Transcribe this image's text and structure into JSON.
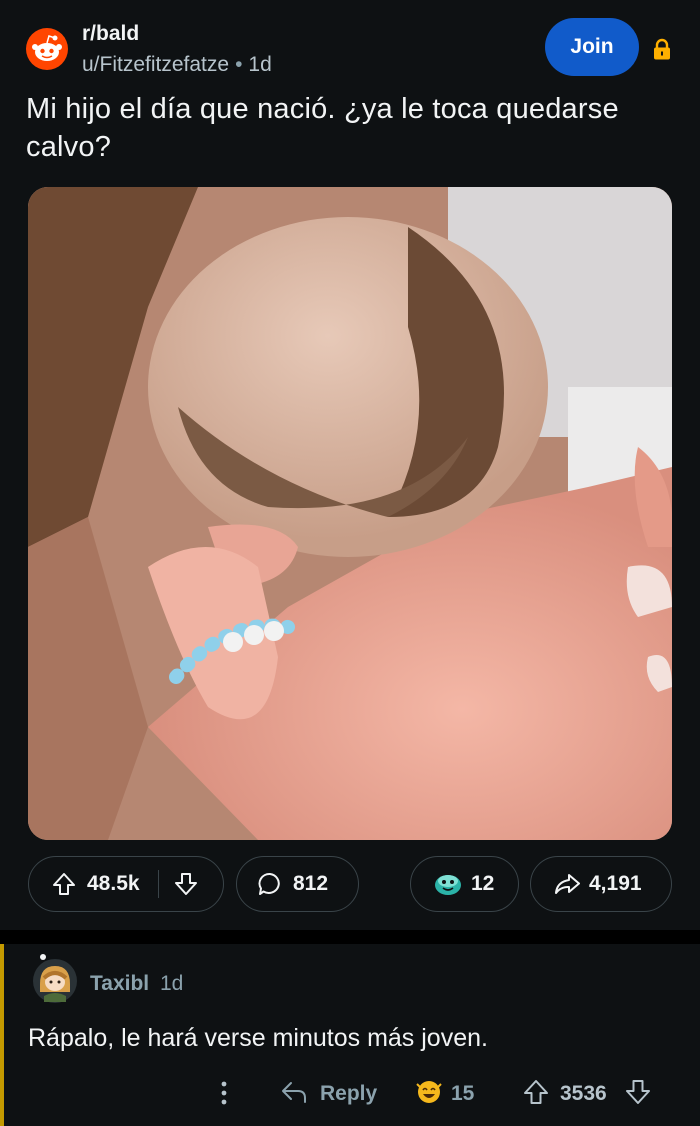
{
  "post": {
    "subreddit": "r/bald",
    "author": "u/Fitzefitzefatze",
    "separator": "•",
    "age": "1d",
    "join_label": "Join",
    "title": "Mi hijo el día que nació. ¿ya le toca quedarse calvo?",
    "votes": "48.5k",
    "comments": "812",
    "awards": "12",
    "shares": "4,191"
  },
  "comment": {
    "author": "Taxibl",
    "age": "1d",
    "text": "Rápalo, le hará verse minutos más joven.",
    "reply_label": "Reply",
    "awards": "15",
    "score": "3536"
  },
  "colors": {
    "background": "#0e1113",
    "join_button": "#115bca",
    "subreddit_icon": "#ff4500",
    "lock": "#ffb000",
    "thread_bar": "#c49a00"
  },
  "icons": {
    "lock": "lock-icon",
    "upvote": "arrow-up-icon",
    "downvote": "arrow-down-icon",
    "comments": "speech-bubble-icon",
    "award": "award-icon",
    "share": "share-arrow-icon",
    "more": "vertical-dots-icon",
    "reply": "reply-arrow-icon"
  }
}
